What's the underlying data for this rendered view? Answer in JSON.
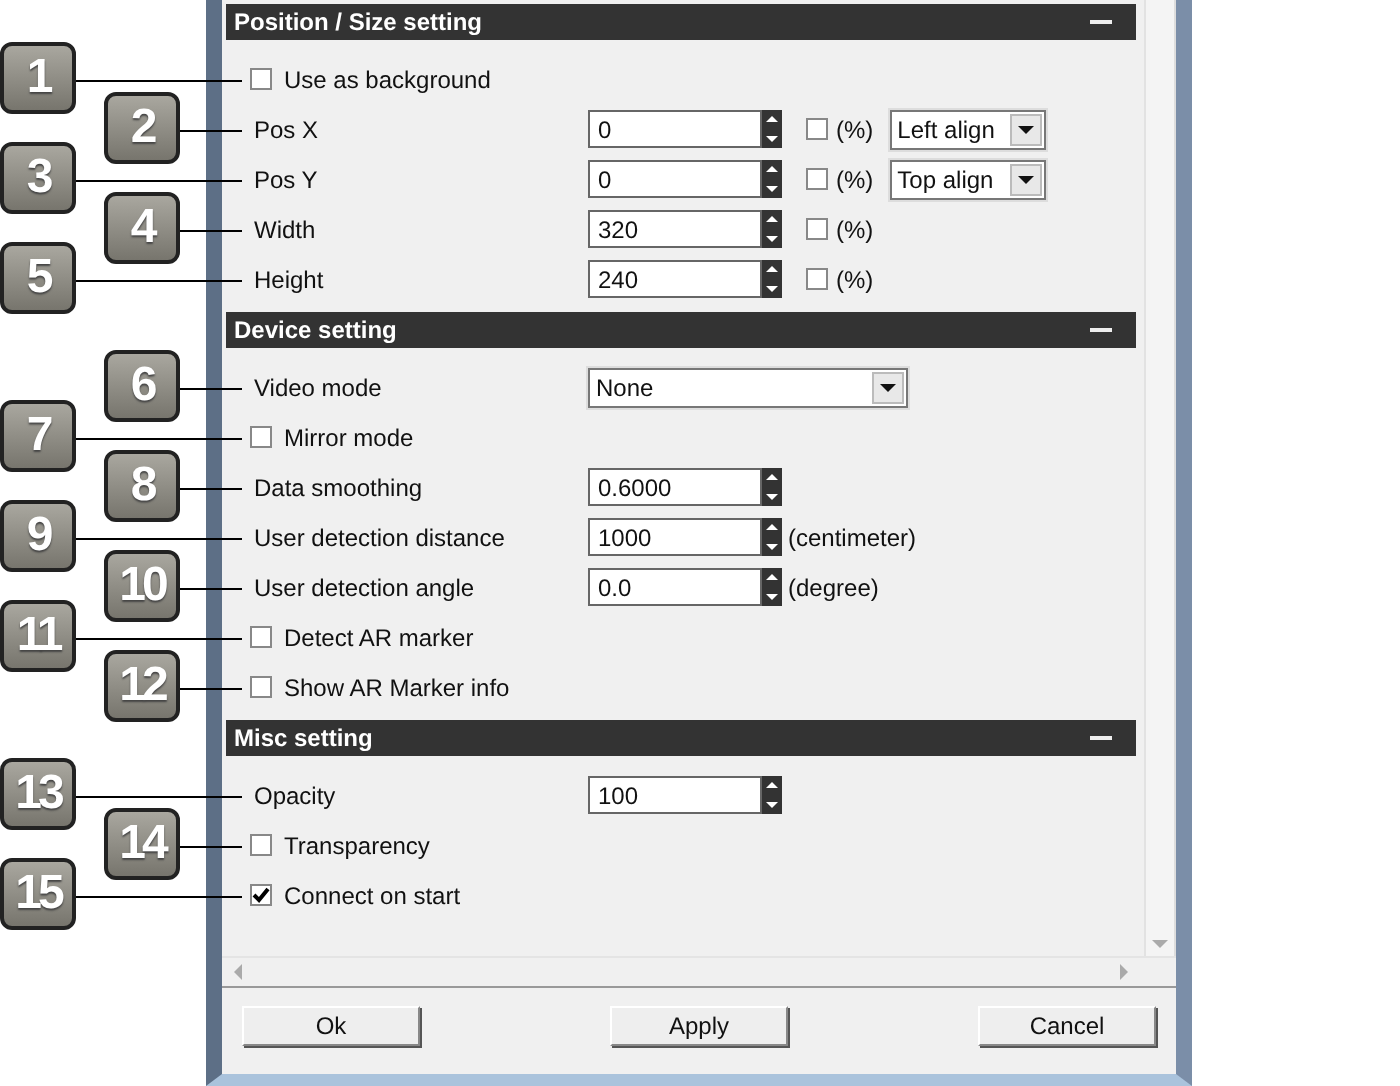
{
  "sections": [
    {
      "title": "Position / Size setting",
      "rows": [
        {
          "kind": "checkbox",
          "callout": "1",
          "label": "Use as background",
          "checked": false
        },
        {
          "kind": "spinner",
          "callout": "2",
          "label": "Pos X",
          "value": "0",
          "percent": {
            "label": "(%)",
            "checked": false
          },
          "align": "Left align"
        },
        {
          "kind": "spinner",
          "callout": "3",
          "label": "Pos Y",
          "value": "0",
          "percent": {
            "label": "(%)",
            "checked": false
          },
          "align": "Top align"
        },
        {
          "kind": "spinner",
          "callout": "4",
          "label": "Width",
          "value": "320",
          "percent": {
            "label": "(%)",
            "checked": false
          }
        },
        {
          "kind": "spinner",
          "callout": "5",
          "label": "Height",
          "value": "240",
          "percent": {
            "label": "(%)",
            "checked": false
          }
        }
      ]
    },
    {
      "title": "Device setting",
      "rows": [
        {
          "kind": "select",
          "callout": "6",
          "label": "Video mode",
          "value": "None"
        },
        {
          "kind": "checkbox",
          "callout": "7",
          "label": "Mirror mode",
          "checked": false
        },
        {
          "kind": "spinner",
          "callout": "8",
          "label": "Data smoothing",
          "value": "0.6000"
        },
        {
          "kind": "spinner",
          "callout": "9",
          "label": "User detection distance",
          "value": "1000",
          "unit": "(centimeter)"
        },
        {
          "kind": "spinner",
          "callout": "10",
          "label": "User detection angle",
          "value": "0.0",
          "unit": "(degree)"
        },
        {
          "kind": "checkbox",
          "callout": "11",
          "label": "Detect AR marker",
          "checked": false
        },
        {
          "kind": "checkbox",
          "callout": "12",
          "label": "Show AR Marker info",
          "checked": false
        }
      ]
    },
    {
      "title": "Misc setting",
      "rows": [
        {
          "kind": "spinner",
          "callout": "13",
          "label": "Opacity",
          "value": "100"
        },
        {
          "kind": "checkbox",
          "callout": "14",
          "label": "Transparency",
          "checked": false
        },
        {
          "kind": "checkbox",
          "callout": "15",
          "label": "Connect on start",
          "checked": true
        }
      ]
    }
  ],
  "buttons": [
    "Ok",
    "Apply",
    "Cancel"
  ]
}
